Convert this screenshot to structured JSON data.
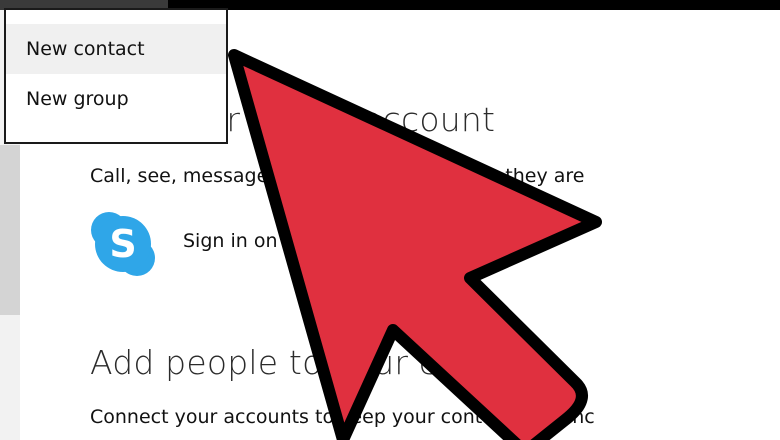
{
  "menu": {
    "items": [
      {
        "label": "New contact"
      },
      {
        "label": "New group"
      }
    ]
  },
  "account_section": {
    "heading": "Add your Skype account",
    "description": "Call, see, message your friends – wherever they are",
    "sign_in_label": "Sign in on Skype"
  },
  "people_section": {
    "heading": "Add people to your contacts",
    "description": "Connect your accounts to keep your contacts in sync"
  },
  "colors": {
    "skype_blue": "#2fa6e8",
    "arrow_red": "#e0303f",
    "menu_highlight": "#f0f0f0"
  },
  "icons": {
    "skype": "skype-icon",
    "overlay": "pointer-arrow-icon"
  }
}
